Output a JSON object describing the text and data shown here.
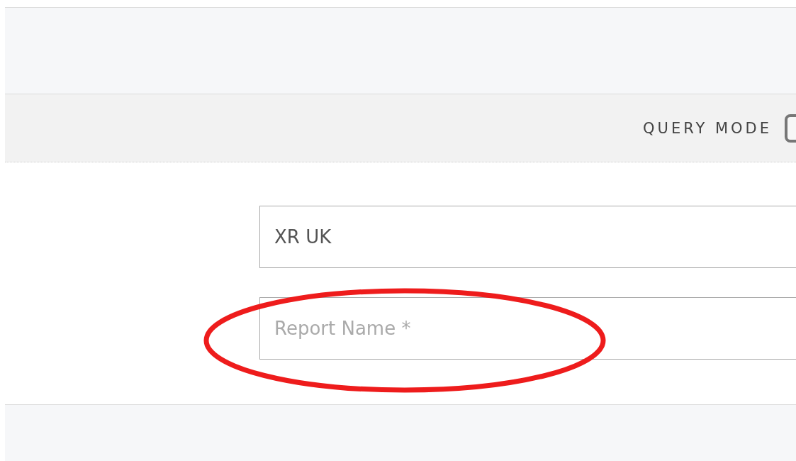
{
  "toolbar": {
    "query_mode": {
      "label": "QUERY MODE",
      "checked": false
    }
  },
  "form": {
    "fields": [
      {
        "value": "XR UK"
      },
      {
        "placeholder": "Report Name *"
      }
    ]
  },
  "annotations": [
    {
      "kind": "ellipse",
      "color": "#ee1c1c"
    }
  ]
}
